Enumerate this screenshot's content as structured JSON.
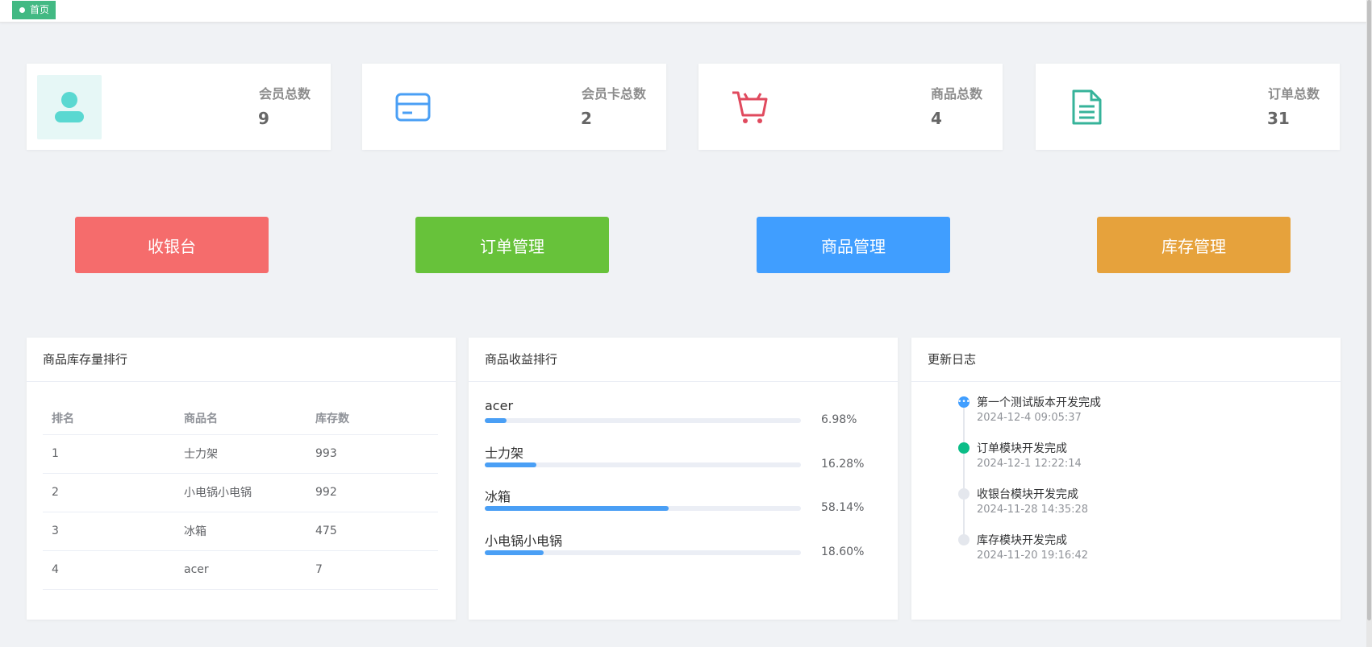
{
  "tabs": {
    "home_label": "首页"
  },
  "stats": [
    {
      "label": "会员总数",
      "value": "9",
      "icon": "user-icon",
      "color": "#5ad8d1"
    },
    {
      "label": "会员卡总数",
      "value": "2",
      "icon": "credit-card-icon",
      "color": "#4a9ff5"
    },
    {
      "label": "商品总数",
      "value": "4",
      "icon": "shopping-cart-icon",
      "color": "#e04a5e"
    },
    {
      "label": "订单总数",
      "value": "31",
      "icon": "document-icon",
      "color": "#36b39a"
    }
  ],
  "quick_actions": [
    {
      "label": "收银台",
      "color": "#f56c6c"
    },
    {
      "label": "订单管理",
      "color": "#67c23a"
    },
    {
      "label": "商品管理",
      "color": "#409eff"
    },
    {
      "label": "库存管理",
      "color": "#e6a23c"
    }
  ],
  "stock_ranking": {
    "title": "商品库存量排行",
    "columns": [
      "排名",
      "商品名",
      "库存数"
    ],
    "rows": [
      [
        "1",
        "士力架",
        "993"
      ],
      [
        "2",
        "小电锅小电锅",
        "992"
      ],
      [
        "3",
        "冰箱",
        "475"
      ],
      [
        "4",
        "acer",
        "7"
      ]
    ]
  },
  "revenue_ranking": {
    "title": "商品收益排行",
    "items": [
      {
        "name": "acer",
        "percent": 6.98,
        "label": "6.98%"
      },
      {
        "name": "士力架",
        "percent": 16.28,
        "label": "16.28%"
      },
      {
        "name": "冰箱",
        "percent": 58.14,
        "label": "58.14%"
      },
      {
        "name": "小电锅小电锅",
        "percent": 18.6,
        "label": "18.60%"
      }
    ]
  },
  "changelog": {
    "title": "更新日志",
    "items": [
      {
        "text": "第一个测试版本开发完成",
        "time": "2024-12-4 09:05:37",
        "node_color": "#409eff"
      },
      {
        "text": "订单模块开发完成",
        "time": "2024-12-1 12:22:14",
        "node_color": "#0bbd87"
      },
      {
        "text": "收银台模块开发完成",
        "time": "2024-11-28 14:35:28",
        "node_color": "#e4e7ed"
      },
      {
        "text": "库存模块开发完成",
        "time": "2024-11-20 19:16:42",
        "node_color": "#e4e7ed"
      }
    ]
  }
}
